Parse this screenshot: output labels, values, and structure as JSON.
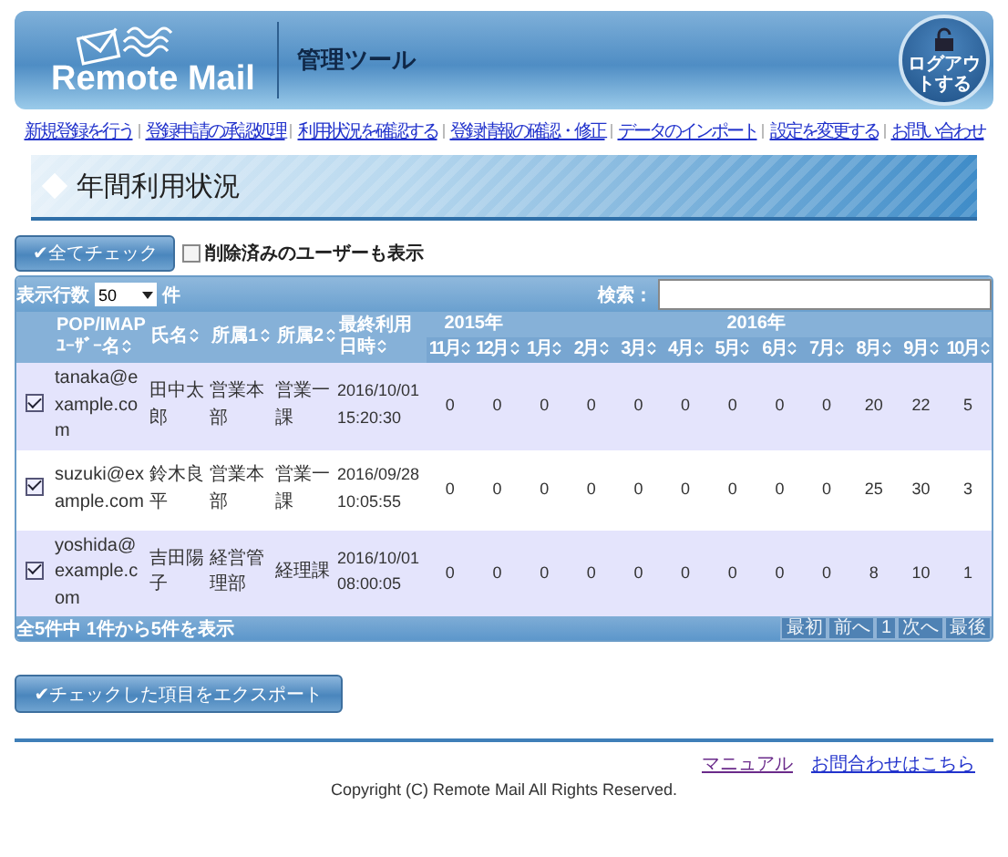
{
  "header": {
    "logo": "Remote Mail",
    "subtitle": "管理ツール",
    "logout": "ログアウトする"
  },
  "nav": [
    "新規登録を行う",
    "登録申請の承認処理",
    "利用状況を確認する",
    "登録情報の確認・修正",
    "データのインポート",
    "設定を変更する",
    "お問い合わせ"
  ],
  "page_title": "年間利用状況",
  "check_all_button": "✔全てチェック",
  "show_deleted": {
    "label": "削除済みのユーザーも表示",
    "checked": false
  },
  "rows_per_page": {
    "label": "表示行数",
    "value": "50",
    "unit": "件"
  },
  "search": {
    "label": "検索："
  },
  "table": {
    "columns": [
      "POP/IMAP ﾕｰｻﾞｰ名",
      "氏名",
      "所属1",
      "所属2",
      "最終利用日時"
    ],
    "years": [
      {
        "label": "2015年",
        "months": [
          "11月",
          "12月"
        ]
      },
      {
        "label": "2016年",
        "months": [
          "1月",
          "2月",
          "3月",
          "4月",
          "5月",
          "6月",
          "7月",
          "8月",
          "9月",
          "10月"
        ]
      }
    ],
    "rows": [
      {
        "checked": true,
        "user": "tanaka@example.com",
        "name": "田中太郎",
        "dept1": "営業本部",
        "dept2": "営業一課",
        "last_used": "2016/10/01 15:20:30",
        "values": [
          "0",
          "0",
          "0",
          "0",
          "0",
          "0",
          "0",
          "0",
          "0",
          "20",
          "22",
          "5"
        ]
      },
      {
        "checked": true,
        "user": "suzuki@example.com",
        "name": "鈴木良平",
        "dept1": "営業本部",
        "dept2": "営業一課",
        "last_used": "2016/09/28 10:05:55",
        "values": [
          "0",
          "0",
          "0",
          "0",
          "0",
          "0",
          "0",
          "0",
          "0",
          "25",
          "30",
          "3"
        ]
      },
      {
        "checked": true,
        "user": "yoshida@example.com",
        "name": "吉田陽子",
        "dept1": "経営管理部",
        "dept2": "経理課",
        "last_used": "2016/10/01 08:00:05",
        "values": [
          "0",
          "0",
          "0",
          "0",
          "0",
          "0",
          "0",
          "0",
          "0",
          "8",
          "10",
          "1"
        ]
      }
    ]
  },
  "summary": "全5件中 1件から5件を表示",
  "pager": [
    {
      "label": "最初",
      "disabled": true
    },
    {
      "label": "前へ",
      "disabled": true
    },
    {
      "label": "1",
      "disabled": true
    },
    {
      "label": "次へ",
      "disabled": true
    },
    {
      "label": "最後",
      "disabled": true
    }
  ],
  "export_button": "✔チェックした項目をエクスポート",
  "footer_links": [
    "マニュアル",
    "お問合わせはこちら"
  ],
  "copyright": "Copyright (C) Remote Mail All Rights Reserved."
}
